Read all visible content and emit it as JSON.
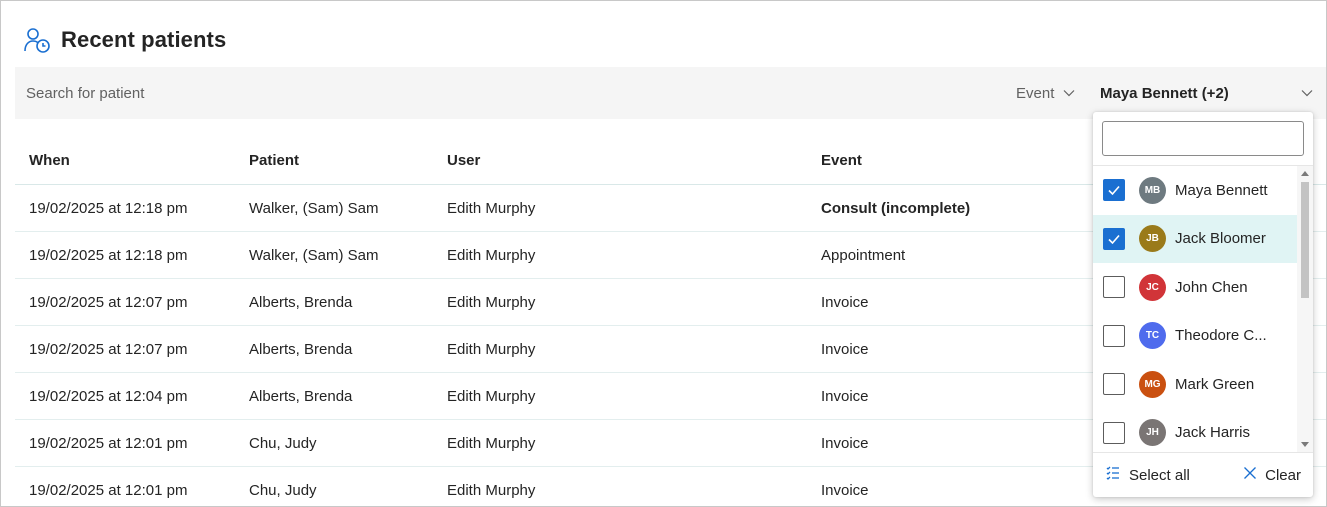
{
  "header": {
    "title": "Recent patients",
    "icon": "patient-clock-icon"
  },
  "toolbar": {
    "search_placeholder": "Search for patient",
    "event_filter_label": "Event",
    "user_filter_label": "Maya Bennett (+2)"
  },
  "table": {
    "columns": [
      "When",
      "Patient",
      "User",
      "Event"
    ],
    "rows": [
      {
        "when": "19/02/2025 at 12:18 pm",
        "patient": "Walker, (Sam) Sam",
        "user": "Edith Murphy",
        "event": "Consult (incomplete)",
        "event_bold": true
      },
      {
        "when": "19/02/2025 at 12:18 pm",
        "patient": "Walker, (Sam) Sam",
        "user": "Edith Murphy",
        "event": "Appointment"
      },
      {
        "when": "19/02/2025 at 12:07 pm",
        "patient": "Alberts, Brenda",
        "user": "Edith Murphy",
        "event": "Invoice"
      },
      {
        "when": "19/02/2025 at 12:07 pm",
        "patient": "Alberts, Brenda",
        "user": "Edith Murphy",
        "event": "Invoice"
      },
      {
        "when": "19/02/2025 at 12:04 pm",
        "patient": "Alberts, Brenda",
        "user": "Edith Murphy",
        "event": "Invoice"
      },
      {
        "when": "19/02/2025 at 12:01 pm",
        "patient": "Chu, Judy",
        "user": "Edith Murphy",
        "event": "Invoice"
      },
      {
        "when": "19/02/2025 at 12:01 pm",
        "patient": "Chu, Judy",
        "user": "Edith Murphy",
        "event": "Invoice"
      }
    ]
  },
  "user_dropdown": {
    "search_value": "",
    "items": [
      {
        "initials": "MB",
        "name": "Maya Bennett",
        "checked": true,
        "color": "#6e7a80"
      },
      {
        "initials": "JB",
        "name": "Jack Bloomer",
        "checked": true,
        "color": "#9a7a1a",
        "highlighted": true
      },
      {
        "initials": "JC",
        "name": "John Chen",
        "checked": false,
        "color": "#d13438"
      },
      {
        "initials": "TC",
        "name": "Theodore C...",
        "checked": false,
        "color": "#4f6bed"
      },
      {
        "initials": "MG",
        "name": "Mark Green",
        "checked": false,
        "color": "#ca5010"
      },
      {
        "initials": "JH",
        "name": "Jack Harris",
        "checked": false,
        "color": "#7a7574"
      }
    ],
    "select_all_label": "Select all",
    "clear_label": "Clear"
  },
  "colors": {
    "accent": "#1a6fd1",
    "highlight_row": "#e0f4f4",
    "toolbar_bg": "#f5f5f5"
  }
}
